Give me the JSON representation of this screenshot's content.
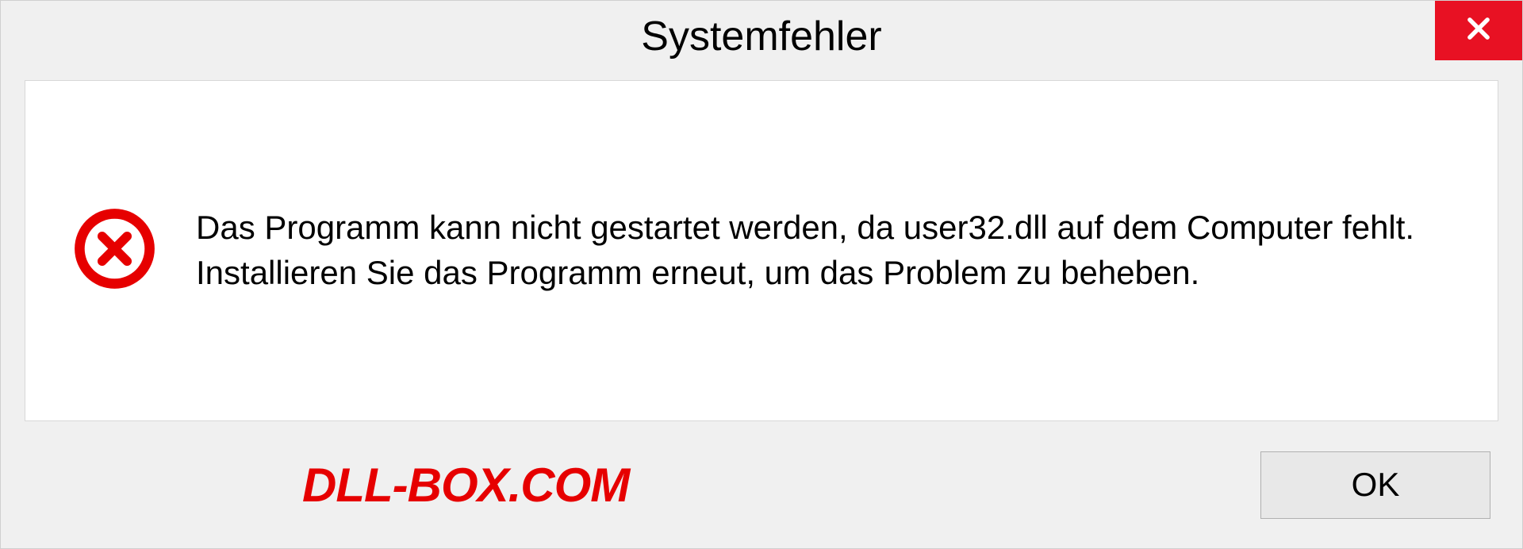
{
  "dialog": {
    "title": "Systemfehler",
    "message": "Das Programm kann nicht gestartet werden, da user32.dll auf dem Computer fehlt. Installieren Sie das Programm erneut, um das Problem zu beheben.",
    "ok_label": "OK"
  },
  "watermark": "DLL-BOX.COM"
}
